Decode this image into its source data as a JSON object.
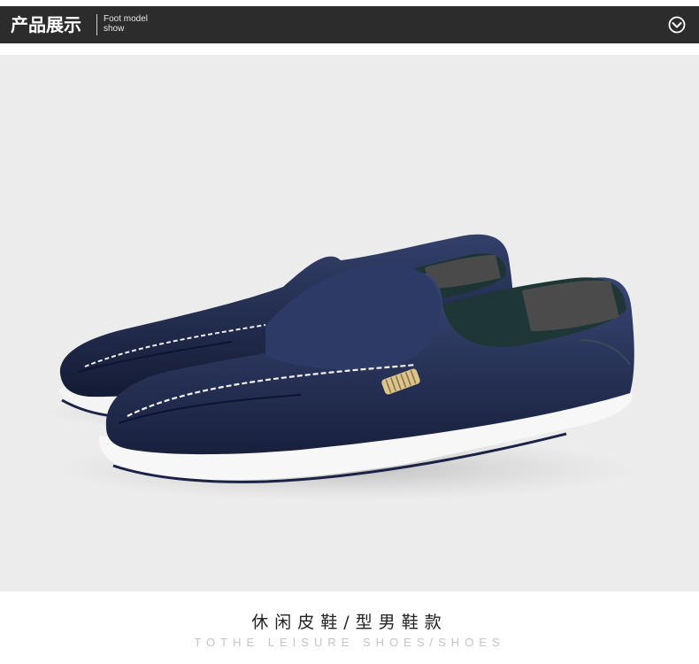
{
  "header": {
    "title": "产品展示",
    "subtitle_line1": "Foot model",
    "subtitle_line2": "show",
    "toggle_icon": "chevron-down-circle-icon"
  },
  "product": {
    "image_alt": "navy leather slip-on loafers pair",
    "shoe_color": "#1f2a4e",
    "sole_color": "#f7f7f7"
  },
  "caption": {
    "title_cn": "休闲皮鞋/型男鞋款",
    "title_en": "TOTHE LEISURE SHOES/SHOES"
  }
}
